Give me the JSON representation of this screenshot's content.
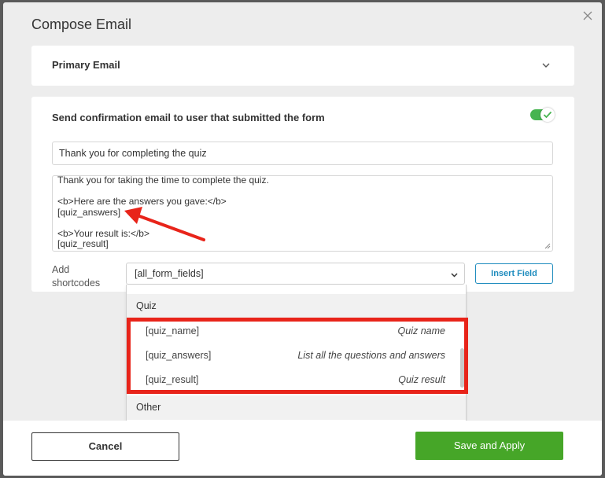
{
  "dialog": {
    "title": "Compose Email"
  },
  "primary_section": {
    "label": "Primary Email"
  },
  "confirmation_section": {
    "label": "Send confirmation email to user that submitted the form",
    "toggle_on": true,
    "subject_value": "Thank you for completing the quiz",
    "body_lines": [
      "Thank you for taking the time to complete the quiz.",
      "",
      "<b>Here are the answers you gave:</b>",
      "[quiz_answers]",
      "",
      "<b>Your result is:</b>",
      "[quiz_result]"
    ],
    "shortcodes_label": "Add shortcodes",
    "shortcodes_selected": "[all_form_fields]",
    "insert_button_label": "Insert Field"
  },
  "dropdown": {
    "groups": [
      {
        "label": "Quiz"
      },
      {
        "label": "Other"
      }
    ],
    "items": [
      {
        "code": "[quiz_name]",
        "description": "Quiz name"
      },
      {
        "code": "[quiz_answers]",
        "description": "List all the questions and answers"
      },
      {
        "code": "[quiz_result]",
        "description": "Quiz result"
      }
    ]
  },
  "footer": {
    "cancel_label": "Cancel",
    "save_label": "Save and Apply"
  },
  "colors": {
    "toggle_on": "#46b450",
    "save_button": "#46a628",
    "insert_button": "#1e8cbe",
    "annotation_red": "#e8241a"
  }
}
